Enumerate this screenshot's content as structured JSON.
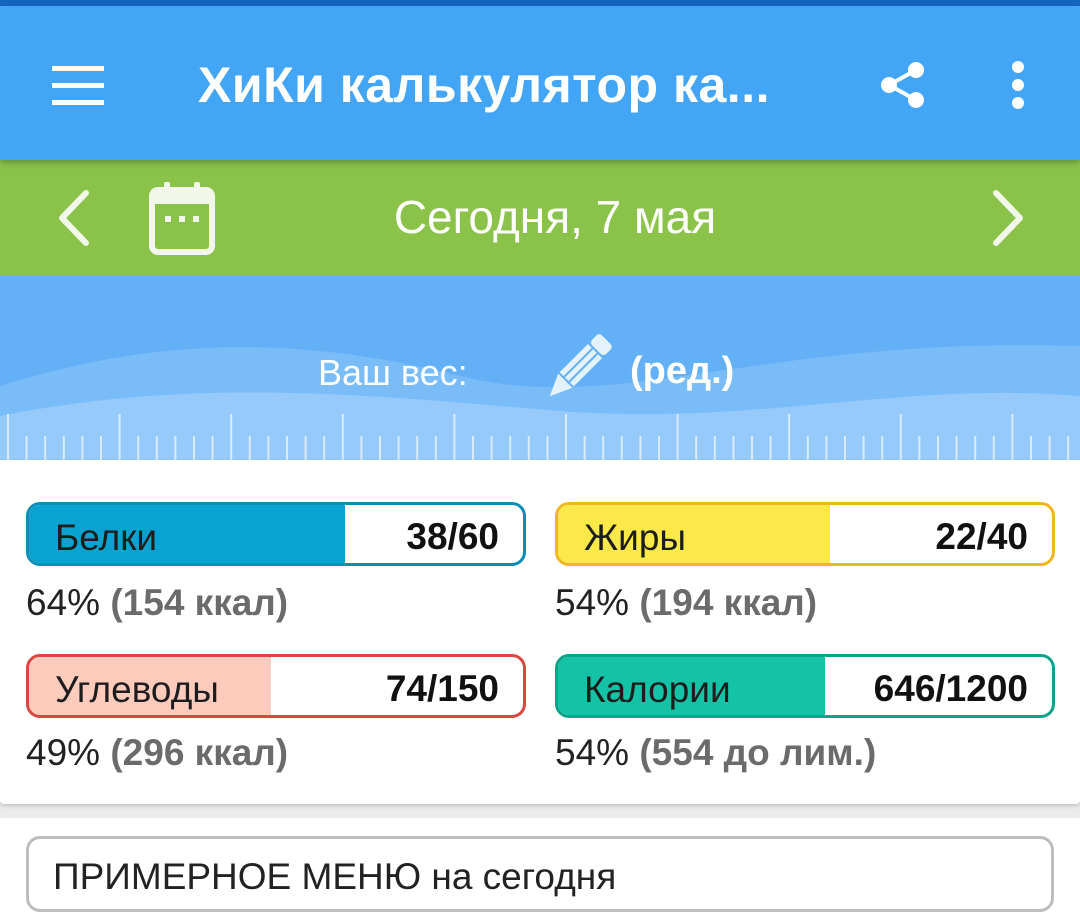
{
  "app_bar": {
    "title": "ХиКи калькулятор ка...",
    "icons": [
      "hamburger-menu-icon",
      "share-icon",
      "more-vertical-icon"
    ]
  },
  "date_bar": {
    "date_label": "Сегодня, 7 мая",
    "icons": [
      "chevron-left-icon",
      "calendar-icon",
      "chevron-right-icon"
    ]
  },
  "weight": {
    "label": "Ваш вес:",
    "edit_label": "(ред.)",
    "icon": "pencil-icon"
  },
  "macros": [
    {
      "name": "Белки",
      "value": "38/60",
      "progress": 0.64,
      "percent": "64%",
      "detail": "(154 ккал)",
      "fill_color": "#0aa3d1",
      "border_color": "#0b8fb8"
    },
    {
      "name": "Жиры",
      "value": "22/40",
      "progress": 0.55,
      "percent": "54%",
      "detail": "(194 ккал)",
      "fill_color": "#fbe94a",
      "border_color": "#f0b520"
    },
    {
      "name": "Углеводы",
      "value": "74/150",
      "progress": 0.49,
      "percent": "49%",
      "detail": "(296 ккал)",
      "fill_color": "#ffcbbc",
      "border_color": "#d9473f"
    },
    {
      "name": "Калории",
      "value": "646/1200",
      "progress": 0.54,
      "percent": "54%",
      "detail": "(554 до лим.)",
      "fill_color": "#14c3a5",
      "border_color": "#0ea28a"
    }
  ],
  "sample_menu": {
    "label": "ПРИМЕРНОЕ МЕНЮ на сегодня"
  },
  "colors": {
    "app_bar": "#42a5f5",
    "date_bar": "#8bc34a",
    "weight_bg": "#64b0f7"
  }
}
